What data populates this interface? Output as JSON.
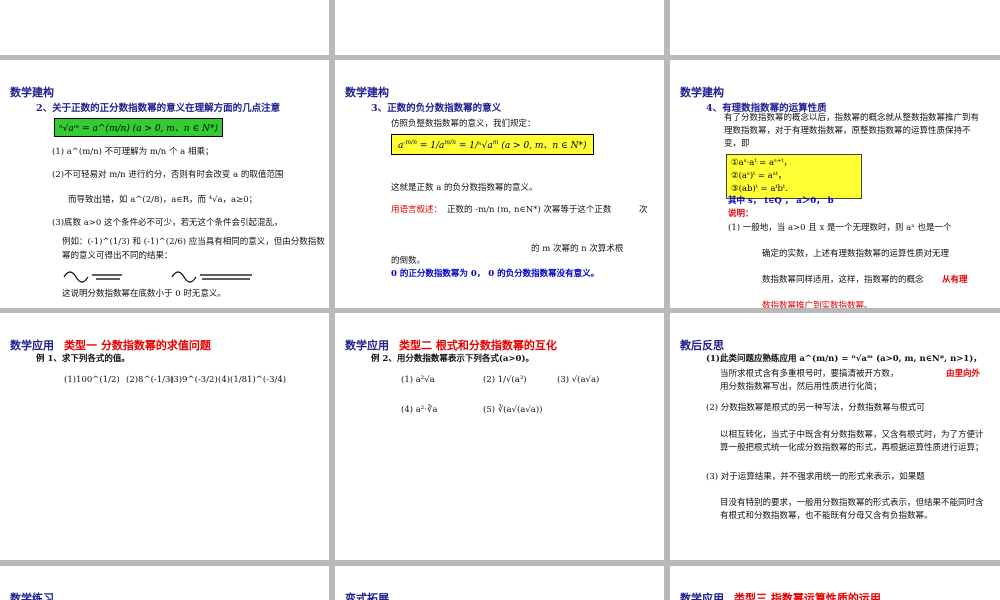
{
  "s2": {
    "header": "数学建构",
    "sub": "2、关于正数的正分数指数幂的意义在理解方面的几点注意",
    "box": "ⁿ√aᵐ = a^(m/n) (a > 0, m、n ∈ N*)",
    "p1": "(1) a^(m/n) 不可理解为 m/n 个 a 相乘；",
    "p2": "(2)不可轻易对 m/n 进行约分，否则有时会改变 a 的取值范围",
    "p2b": "而导致出错，如 a^(2/8)，a∈R，而 ⁴√a，a≥0；",
    "p3": "(3)底数 a>0 这个条件必不可少，若无这个条件会引起混乱，",
    "p3b": "例如：(-1)^(1/3) 和 (-1)^(2/6) 应当具有相同的意义，但由分数指数",
    "p3c": "幂的意义可得出不同的结果：",
    "p3d": "这说明分数指数幂在底数小于 0 时无意义。"
  },
  "s3": {
    "header": "数学建构",
    "sub": "3、正数的负分数指数幂的意义",
    "p1": "仿照负整数指数幂的意义，我们规定：",
    "box": "(a > 0, m、n ∈ N*)",
    "p2": "这就是正数 a 的负分数指数幂的意义。",
    "p3_red": "用语言叙述：",
    "p3": "正数的 -m/n (m, n∈N*) 次幂等于这个正数",
    "p3_right": "次",
    "p4": "的 m 次幂的 n 次算术根",
    "p4b": "的倒数。",
    "p5": "0 的正分数指数幂为 0，    0 的负分数指数幂没有意义。"
  },
  "s4": {
    "header": "数学建构",
    "sub": "4、有理数指数幂的运算性质",
    "p1": "有了分数指数幂的概念以后，指数幂的概念就从整数指数幂推广到有理数指数幂，对于有理数指数幂，原整数指数幂的运算性质保持不变，即",
    "r1": "①aˢ·aᵗ = aˢ⁺ᵗ，",
    "r2": "②(aˢ)ᵗ = aˢᵗ，",
    "r3": "③(ab)ᵗ = aᵗbᵗ.",
    "r4": "其中 s， t∈Q ， a＞0， b",
    "r5": "说明：",
    "p2": "(1) 一般地，当 a>0 且 x 是一个无理数时，则 aˣ 也是一个",
    "p3": "确定的实数，上述有理数指数幂的运算性质对无理",
    "p4": "数指数幂同样适用，这样，指数幂的的概念",
    "p4_red": "从有理",
    "p5": "数指数幂推广到实数指数幂。"
  },
  "s5": {
    "header": "数学应用",
    "tag": "类型一  分数指数幂的求值问题",
    "ex": "例 1、求下列各式的值。",
    "items": [
      "(1)100^(1/2)",
      "(2)8^(-1/3)",
      "(3)9^(-3/2)",
      "(4)(1/81)^(-3/4)"
    ]
  },
  "s6": {
    "header": "数学应用",
    "tag": "类型二  根式和分数指数幂的互化",
    "ex": "例 2、用分数指数幂表示下列各式(a>0)。",
    "items": [
      "(1) a²√a",
      "(2) 1/√(a³)",
      "(3) √(a√a)",
      "(4) a²·∛a",
      "(5) ∛(a√(a√a))"
    ]
  },
  "s7": {
    "header": "教后反思",
    "p1": "(1)此类问题应熟练应用 a^(m/n) = ⁿ√aᵐ (a>0, m, n∈N*, n>1)，",
    "p1b": "当所求根式含有多重根号时，要搞清被开方数，",
    "p1_red": "由里向外",
    "p1c": "用分数指数幂写出，然后用性质进行化简；",
    "p2": "(2) 分数指数幂是根式的另一种写法，分数指数幂与根式可",
    "p2b": "以相互转化，当式子中既含有分数指数幂，又含有根式时，为了方便计算一般把根式统一化成分数指数幂的形式，再根据运算性质进行运算；",
    "p3": "(3) 对于运算结果，并不强求用统一的形式来表示，如果题",
    "p3b": "目没有特别的要求，一般用分数指数幂的形式表示，但结果不能同时含有根式和分数指数幂，也不能既有分母又含有负指数幂。"
  },
  "s8": {
    "header": "数学练习"
  },
  "s9": {
    "header": "变式拓展"
  },
  "s10": {
    "header": "数学应用",
    "tag": "类型三  指数幂运算性质的运用"
  }
}
